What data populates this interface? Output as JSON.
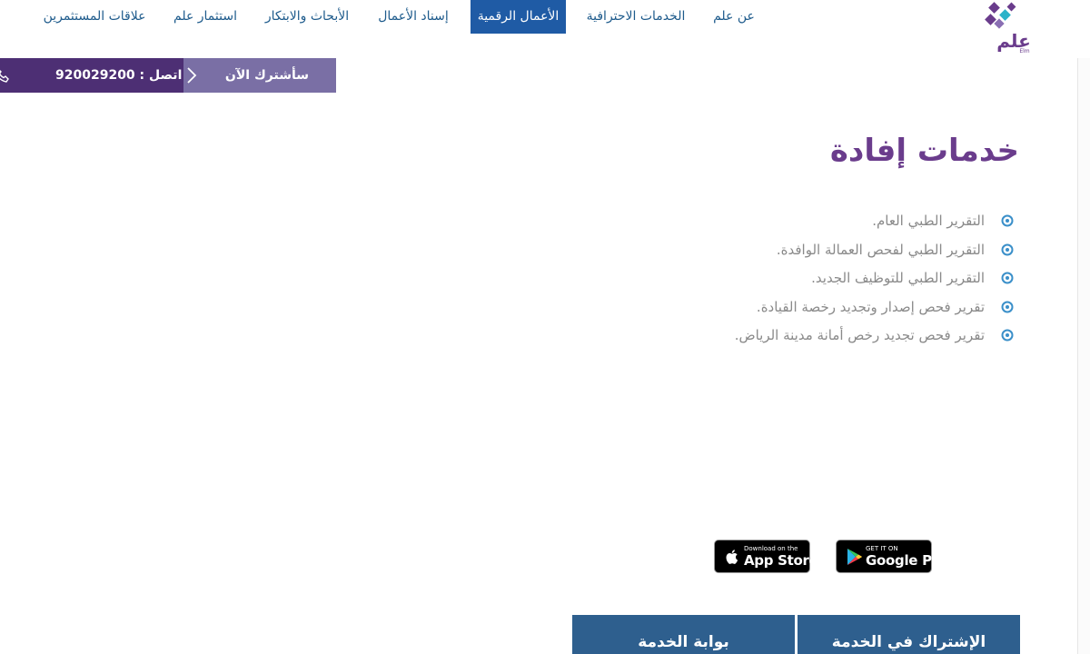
{
  "brand": {
    "logo_text": "علم",
    "logo_subtext": "Elm",
    "colors": {
      "purple": "#4d2f74",
      "lavender": "#7a6fa5",
      "nav_active": "#1f5ba5",
      "title": "#6a3c8c",
      "button_blue": "#2e5f8e"
    }
  },
  "nav": {
    "items": [
      {
        "label": "عن علم",
        "active": false
      },
      {
        "label": "الخدمات الاحترافية",
        "active": false
      },
      {
        "label": "الأعمال الرقمية",
        "active": true
      },
      {
        "label": "إسناد الأعمال",
        "active": false
      },
      {
        "label": "الأبحاث والابتكار",
        "active": false
      },
      {
        "label": "استثمار علم",
        "active": false
      },
      {
        "label": "علاقات المستثمرين",
        "active": false
      }
    ]
  },
  "callbar": {
    "subscribe_label": "سأشترك الآن",
    "call_label": "اتصل : 920029200",
    "icons": [
      "chevron-right-icon",
      "phone-icon"
    ]
  },
  "main": {
    "title": "خدمات إفادة",
    "services": [
      "التقرير الطبي العام.",
      "التقرير الطبي لفحص العمالة الوافدة.",
      "التقرير الطبي للتوظيف الجديد.",
      "تقرير فحص إصدار وتجديد رخصة القيادة.",
      "تقرير فحص تجديد رخص أمانة مدينة الرياض."
    ]
  },
  "badges": {
    "appstore": {
      "small": "Download on the",
      "big": "App Store",
      "icon": "apple-icon"
    },
    "googleplay": {
      "small": "GET IT ON",
      "big": "Google Play",
      "icon": "google-play-icon"
    }
  },
  "bottom_buttons": {
    "subscribe": "الإشتراك في الخدمة",
    "portal": "بوابة الخدمة"
  }
}
